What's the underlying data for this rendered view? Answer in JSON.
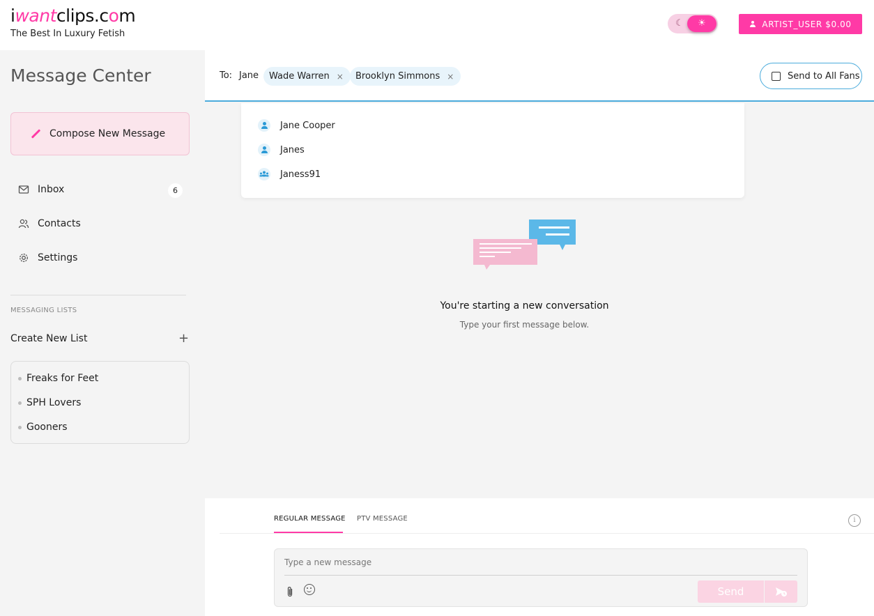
{
  "header": {
    "logo_prefix": "i",
    "logo_want": "want",
    "logo_clips": "clips.c",
    "logo_o": "o",
    "logo_m": "m",
    "tagline": "The Best In Luxury Fetish",
    "user_button": "ARTIST_USER $0.00",
    "moon_glyph": "☾",
    "sun_glyph": "☀"
  },
  "sidebar": {
    "title": "Message Center",
    "compose_label": "Compose New Message",
    "nav": [
      {
        "label": "Inbox",
        "count": "6"
      },
      {
        "label": "Contacts"
      },
      {
        "label": "Settings"
      }
    ],
    "messaging_lists_label": "MESSAGING LISTS",
    "create_list_label": "Create New List",
    "plus_glyph": "+",
    "lists": [
      "Freaks for Feet",
      "SPH Lovers",
      "Gooners"
    ]
  },
  "recipient_bar": {
    "to_label": "To:",
    "typed_text": "Jane",
    "chips": [
      "Wade Warren",
      "Brooklyn Simmons"
    ],
    "chip_remove_glyph": "×",
    "send_all_label": "Send to All Fans"
  },
  "suggestions": [
    {
      "name": "Jane Cooper",
      "kind": "user"
    },
    {
      "name": "Janes",
      "kind": "user"
    },
    {
      "name": "Janess91",
      "kind": "group"
    }
  ],
  "empty_state": {
    "title": "You're starting a new conversation",
    "subtitle": "Type your first message below."
  },
  "composer": {
    "tabs": [
      "REGULAR MESSAGE",
      "PTV MESSAGE"
    ],
    "active_tab": "REGULAR MESSAGE",
    "placeholder": "Type a new message",
    "send_label": "Send",
    "info_glyph": "i"
  },
  "colors": {
    "accent": "#ff3aa6",
    "link_blue": "#4aabdc",
    "chat_pink": "#f4b9d0",
    "chat_blue": "#5bb8e8"
  }
}
